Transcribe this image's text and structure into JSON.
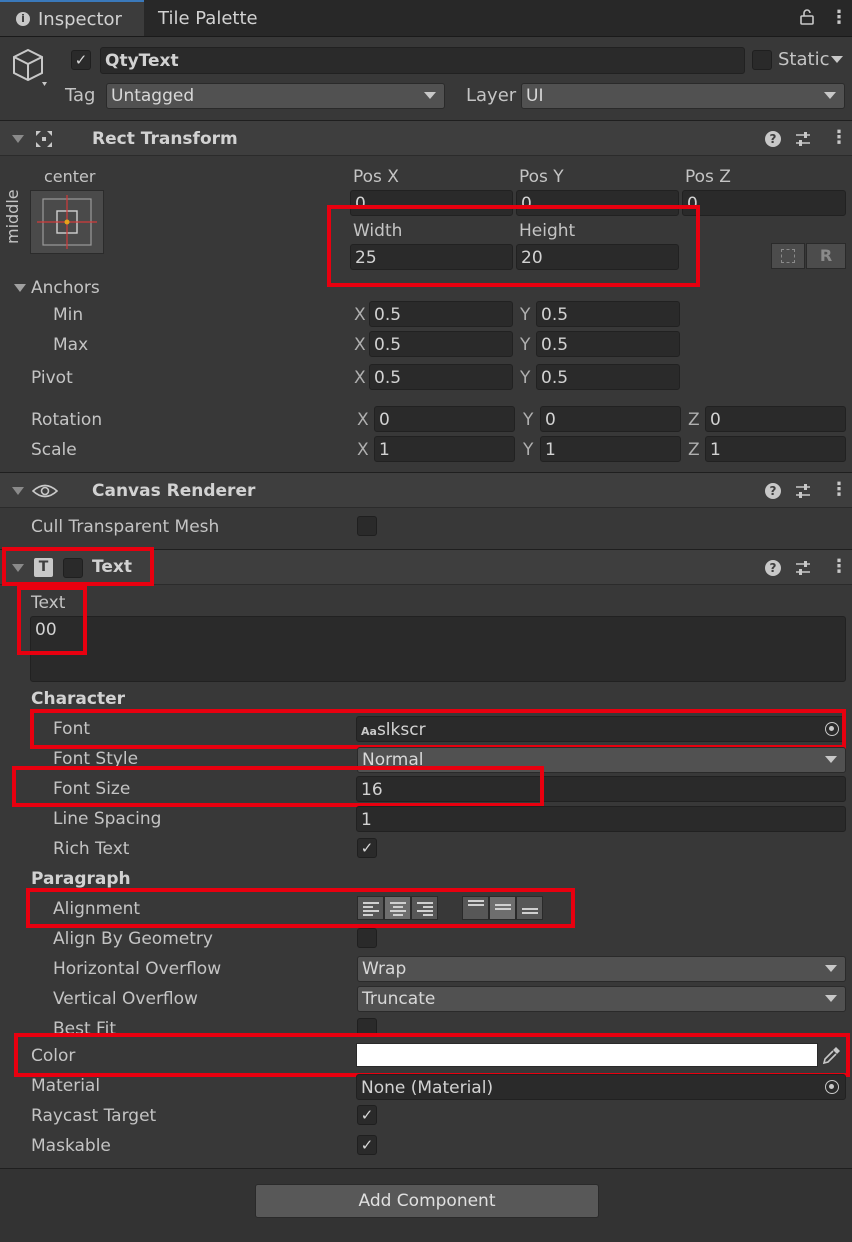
{
  "tabs": {
    "inspector": "Inspector",
    "tile_palette": "Tile Palette"
  },
  "object": {
    "name": "QtyText",
    "active": true,
    "static_label": "Static",
    "tag_label": "Tag",
    "tag_value": "Untagged",
    "layer_label": "Layer",
    "layer_value": "UI"
  },
  "rect_transform": {
    "title": "Rect Transform",
    "anchor_preset": {
      "horizontal": "center",
      "vertical": "middle"
    },
    "pos_x_label": "Pos X",
    "pos_y_label": "Pos Y",
    "pos_z_label": "Pos Z",
    "pos_x": "0",
    "pos_y": "0",
    "pos_z": "0",
    "width_label": "Width",
    "height_label": "Height",
    "width": "25",
    "height": "20",
    "r_button": "R",
    "anchors_label": "Anchors",
    "min_label": "Min",
    "max_label": "Max",
    "pivot_label": "Pivot",
    "min_x": "0.5",
    "min_y": "0.5",
    "max_x": "0.5",
    "max_y": "0.5",
    "pivot_x": "0.5",
    "pivot_y": "0.5",
    "rotation_label": "Rotation",
    "scale_label": "Scale",
    "rot_x": "0",
    "rot_y": "0",
    "rot_z": "0",
    "scale_x": "1",
    "scale_y": "1",
    "scale_z": "1",
    "axis_x": "X",
    "axis_y": "Y",
    "axis_z": "Z"
  },
  "canvas_renderer": {
    "title": "Canvas Renderer",
    "cull_label": "Cull Transparent Mesh",
    "cull": false
  },
  "text_component": {
    "title": "Text",
    "enabled": false,
    "text_label": "Text",
    "text_value": "00",
    "character_label": "Character",
    "font_label": "Font",
    "font_icon": "Aa",
    "font_value": "slkscr",
    "font_style_label": "Font Style",
    "font_style_value": "Normal",
    "font_size_label": "Font Size",
    "font_size_value": "16",
    "line_spacing_label": "Line Spacing",
    "line_spacing_value": "1",
    "rich_text_label": "Rich Text",
    "rich_text": true,
    "paragraph_label": "Paragraph",
    "alignment_label": "Alignment",
    "alignment_h": "center",
    "alignment_v": "middle",
    "align_geometry_label": "Align By Geometry",
    "align_geometry": false,
    "h_overflow_label": "Horizontal Overflow",
    "h_overflow_value": "Wrap",
    "v_overflow_label": "Vertical Overflow",
    "v_overflow_value": "Truncate",
    "best_fit_label": "Best Fit",
    "best_fit": false,
    "color_label": "Color",
    "color_value": "#ffffff",
    "material_label": "Material",
    "material_value": "None (Material)",
    "raycast_label": "Raycast Target",
    "raycast": true,
    "maskable_label": "Maskable",
    "maskable": true
  },
  "add_component": "Add Component",
  "colors": {
    "background": "#383838",
    "highlight": "#e8000f",
    "tab_accent": "#3a79bb"
  }
}
